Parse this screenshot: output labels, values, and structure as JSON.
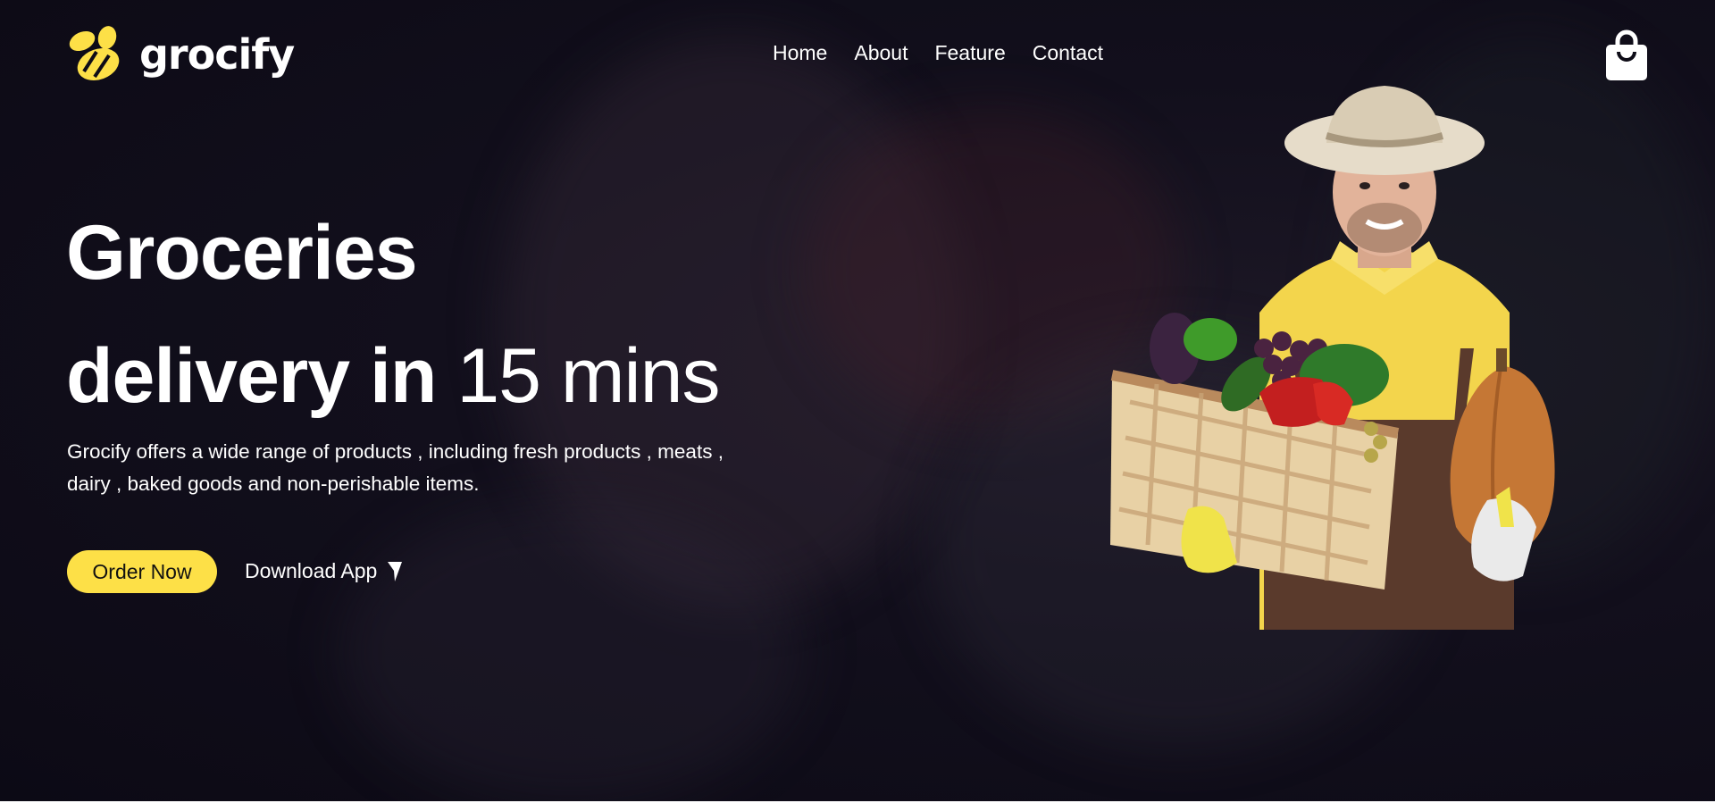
{
  "brand": {
    "name": "grocify",
    "logo_icon": "bee-icon",
    "accent_color": "#fde047",
    "background_color": "#0e0c17"
  },
  "nav": {
    "items": [
      {
        "label": "Home"
      },
      {
        "label": "About"
      },
      {
        "label": "Feature"
      },
      {
        "label": "Contact"
      }
    ],
    "cart_icon": "shopping-bag-icon"
  },
  "hero": {
    "title_line1": "Groceries",
    "title_line2_bold": "delivery in",
    "title_line2_light": "15 mins",
    "description": "Grocify offers a wide range of products , including fresh products , meats , dairy , baked goods and non-perishable items.",
    "order_button": "Order Now",
    "download_label": "Download App",
    "download_icon": "cursor-arrow-icon",
    "image": "farmer-with-vegetable-basket-image"
  }
}
